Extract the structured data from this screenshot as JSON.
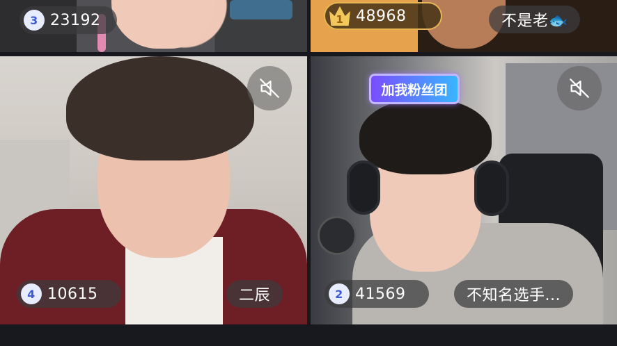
{
  "tiles": [
    {
      "rank": "3",
      "score": "23192",
      "name": ""
    },
    {
      "rank": "1",
      "score": "48968",
      "name": "不是老🐟"
    },
    {
      "rank": "4",
      "score": "10615",
      "name": "二辰"
    },
    {
      "rank": "2",
      "score": "41569",
      "name": "不知名选手..."
    }
  ],
  "fan_club_banner": "加我粉丝团",
  "icons": {
    "mute": "speaker-muted-icon",
    "crown": "crown-icon"
  },
  "colors": {
    "rank_badge_bg": "#e7ecff",
    "rank_badge_text": "#3d5bd6",
    "crown_gold": "#f2c75b"
  }
}
